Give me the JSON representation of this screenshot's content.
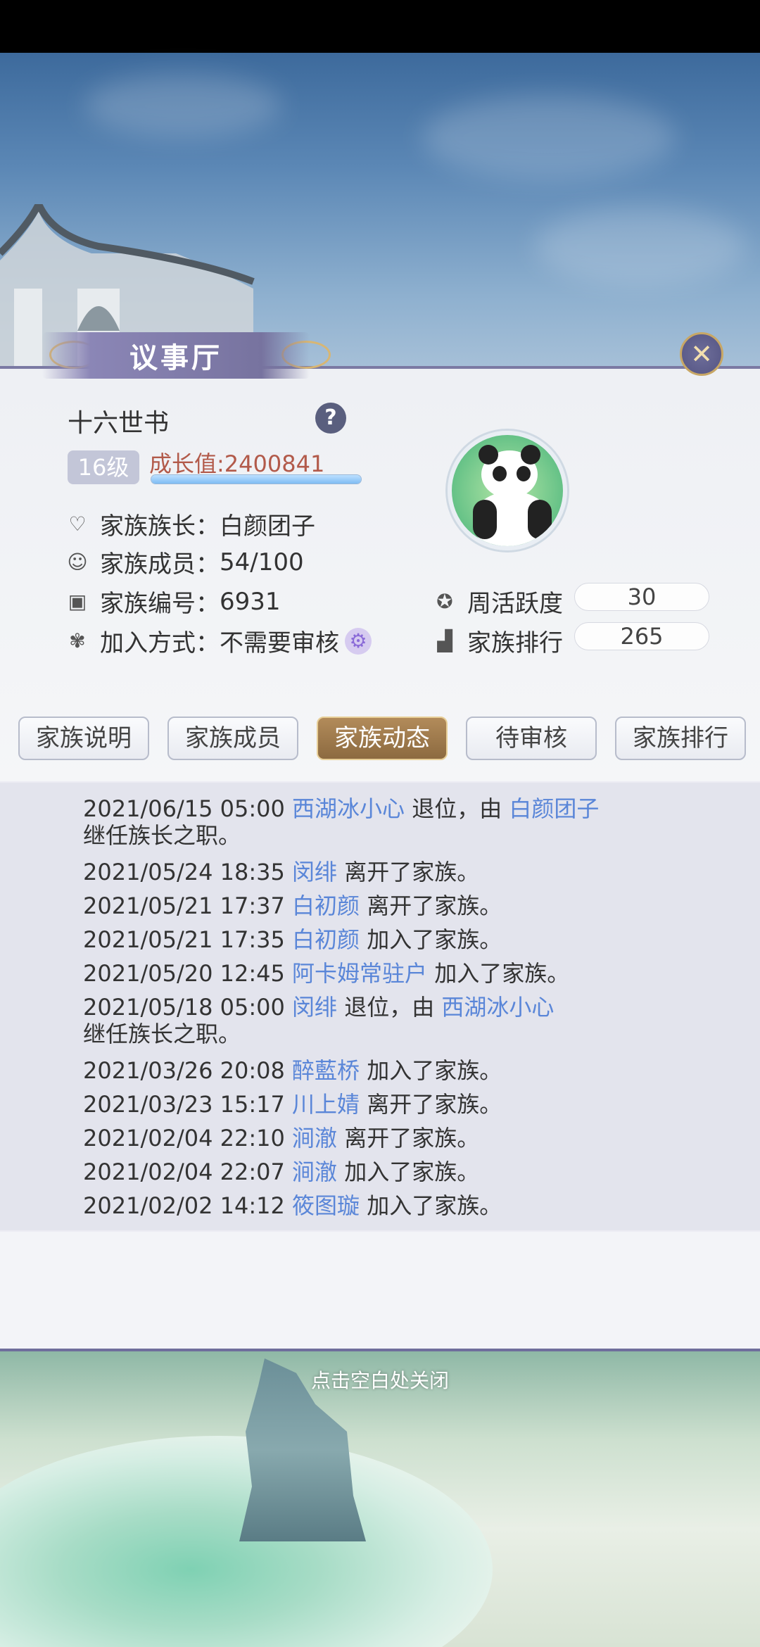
{
  "panel": {
    "title": "议事厅",
    "family_name": "十六世书",
    "help_symbol": "?",
    "level": "16级",
    "growth_label": "成长值:2400841",
    "growth_progress": 1.0,
    "close_symbol": "✕",
    "info": {
      "leader_label": "家族族长：",
      "leader_value": "白颜团子",
      "members_label": "家族成员：",
      "members_value": "54/100",
      "id_label": "家族编号：",
      "id_value": "6931",
      "join_label": "加入方式：",
      "join_value": "不需要审核",
      "weekly_label": "周活跃度",
      "weekly_value": "30",
      "rank_label": "家族排行",
      "rank_value": "265"
    },
    "avatar_icon": "panda-icon"
  },
  "tabs": [
    {
      "label": "家族说明",
      "active": false
    },
    {
      "label": "家族成员",
      "active": false
    },
    {
      "label": "家族动态",
      "active": true
    },
    {
      "label": "待审核",
      "active": false
    },
    {
      "label": "家族排行",
      "active": false
    }
  ],
  "log": [
    {
      "time": "2021/06/15 05:00",
      "name": "西湖冰小心",
      "text": "退位，由",
      "name2": "白颜团子",
      "line2": "继任族长之职。"
    },
    {
      "time": "2021/05/24 18:35",
      "name": "闵绯",
      "text": "离开了家族。"
    },
    {
      "time": "2021/05/21 17:37",
      "name": "白初颜",
      "text": "离开了家族。"
    },
    {
      "time": "2021/05/21 17:35",
      "name": "白初颜",
      "text": "加入了家族。"
    },
    {
      "time": "2021/05/20 12:45",
      "name": "阿卡姆常驻户",
      "text": "加入了家族。"
    },
    {
      "time": "2021/05/18 05:00",
      "name": "闵绯",
      "text": "退位，由",
      "name2": "西湖冰小心",
      "line2": "继任族长之职。"
    },
    {
      "time": "2021/03/26 20:08",
      "name": "醉藍桥",
      "text": "加入了家族。"
    },
    {
      "time": "2021/03/23 15:17",
      "name": "川上婧",
      "text": "离开了家族。"
    },
    {
      "time": "2021/02/04 22:10",
      "name": "涧澈",
      "text": "离开了家族。"
    },
    {
      "time": "2021/02/04 22:07",
      "name": "涧澈",
      "text": "加入了家族。"
    },
    {
      "time": "2021/02/02 14:12",
      "name": "筱图璇",
      "text": "加入了家族。"
    }
  ],
  "footer": {
    "close_hint": "点击空白处关闭"
  },
  "colors": {
    "accent_gold": "#b28b5a",
    "name_blue": "#5a86d8",
    "growth_red": "#b25a4a"
  }
}
